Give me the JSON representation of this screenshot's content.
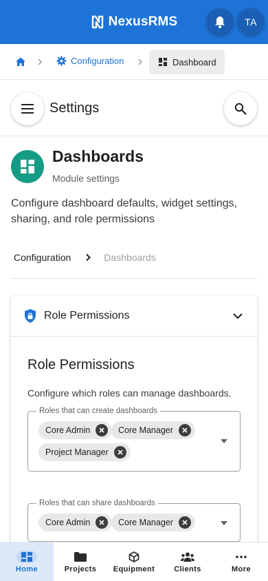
{
  "app": {
    "name": "NexusRMS",
    "avatar_initials": "TA",
    "brand_color": "#1e73d6"
  },
  "breadcrumb": {
    "config_label": "Configuration",
    "current_label": "Dashboard"
  },
  "settings": {
    "title": "Settings"
  },
  "module": {
    "title": "Dashboards",
    "subtitle": "Module settings",
    "description": "Configure dashboard defaults, widget settings, sharing, and role permissions",
    "icon_color": "#169b85"
  },
  "inner_breadcrumb": {
    "parent": "Configuration",
    "current": "Dashboards"
  },
  "card": {
    "header_title": "Role Permissions",
    "title": "Role Permissions",
    "description": "Configure which roles can manage dashboards.",
    "create_field": {
      "label": "Roles that can create dashboards",
      "chips": [
        "Core Admin",
        "Core Manager",
        "Project Manager"
      ]
    },
    "share_field": {
      "label": "Roles that can share dashboards",
      "chips": [
        "Core Admin",
        "Core Manager"
      ]
    }
  },
  "bottom_nav": {
    "items": [
      {
        "label": "Home",
        "icon": "grid-icon",
        "active": true
      },
      {
        "label": "Projects",
        "icon": "folder-icon"
      },
      {
        "label": "Equipment",
        "icon": "cube-icon"
      },
      {
        "label": "Clients",
        "icon": "people-icon"
      },
      {
        "label": "More",
        "icon": "more-icon"
      }
    ]
  }
}
